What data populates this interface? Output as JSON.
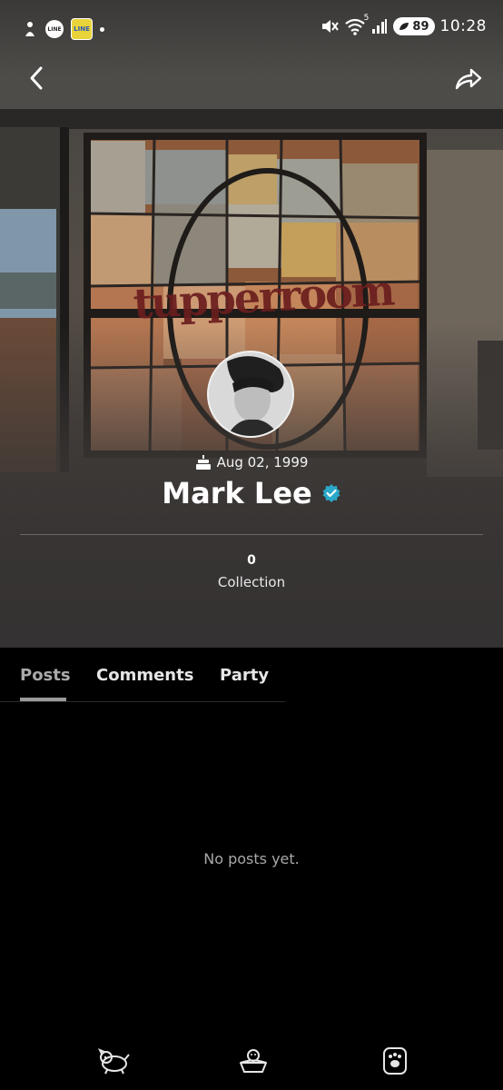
{
  "status_bar": {
    "line_badge": "LINE",
    "app_badge": "LINE",
    "signal_label": "5",
    "battery": "89",
    "time": "10:28"
  },
  "hero": {
    "sign_text": "tupperroom"
  },
  "profile": {
    "birthday": "Aug 02, 1999",
    "name": "Mark Lee",
    "verified": true,
    "collection_count": "0",
    "collection_label": "Collection"
  },
  "tabs": [
    {
      "label": "Posts",
      "active": true
    },
    {
      "label": "Comments",
      "active": false
    },
    {
      "label": "Party",
      "active": false
    }
  ],
  "empty_state": "No posts yet.",
  "bottom_nav": [
    {
      "icon": "puppy-icon"
    },
    {
      "icon": "dog-bowl-icon"
    },
    {
      "icon": "paw-icon"
    }
  ],
  "colors": {
    "verified_badge": "#2aa8c9",
    "background": "#000000",
    "sign_text": "#6b1e1e"
  }
}
